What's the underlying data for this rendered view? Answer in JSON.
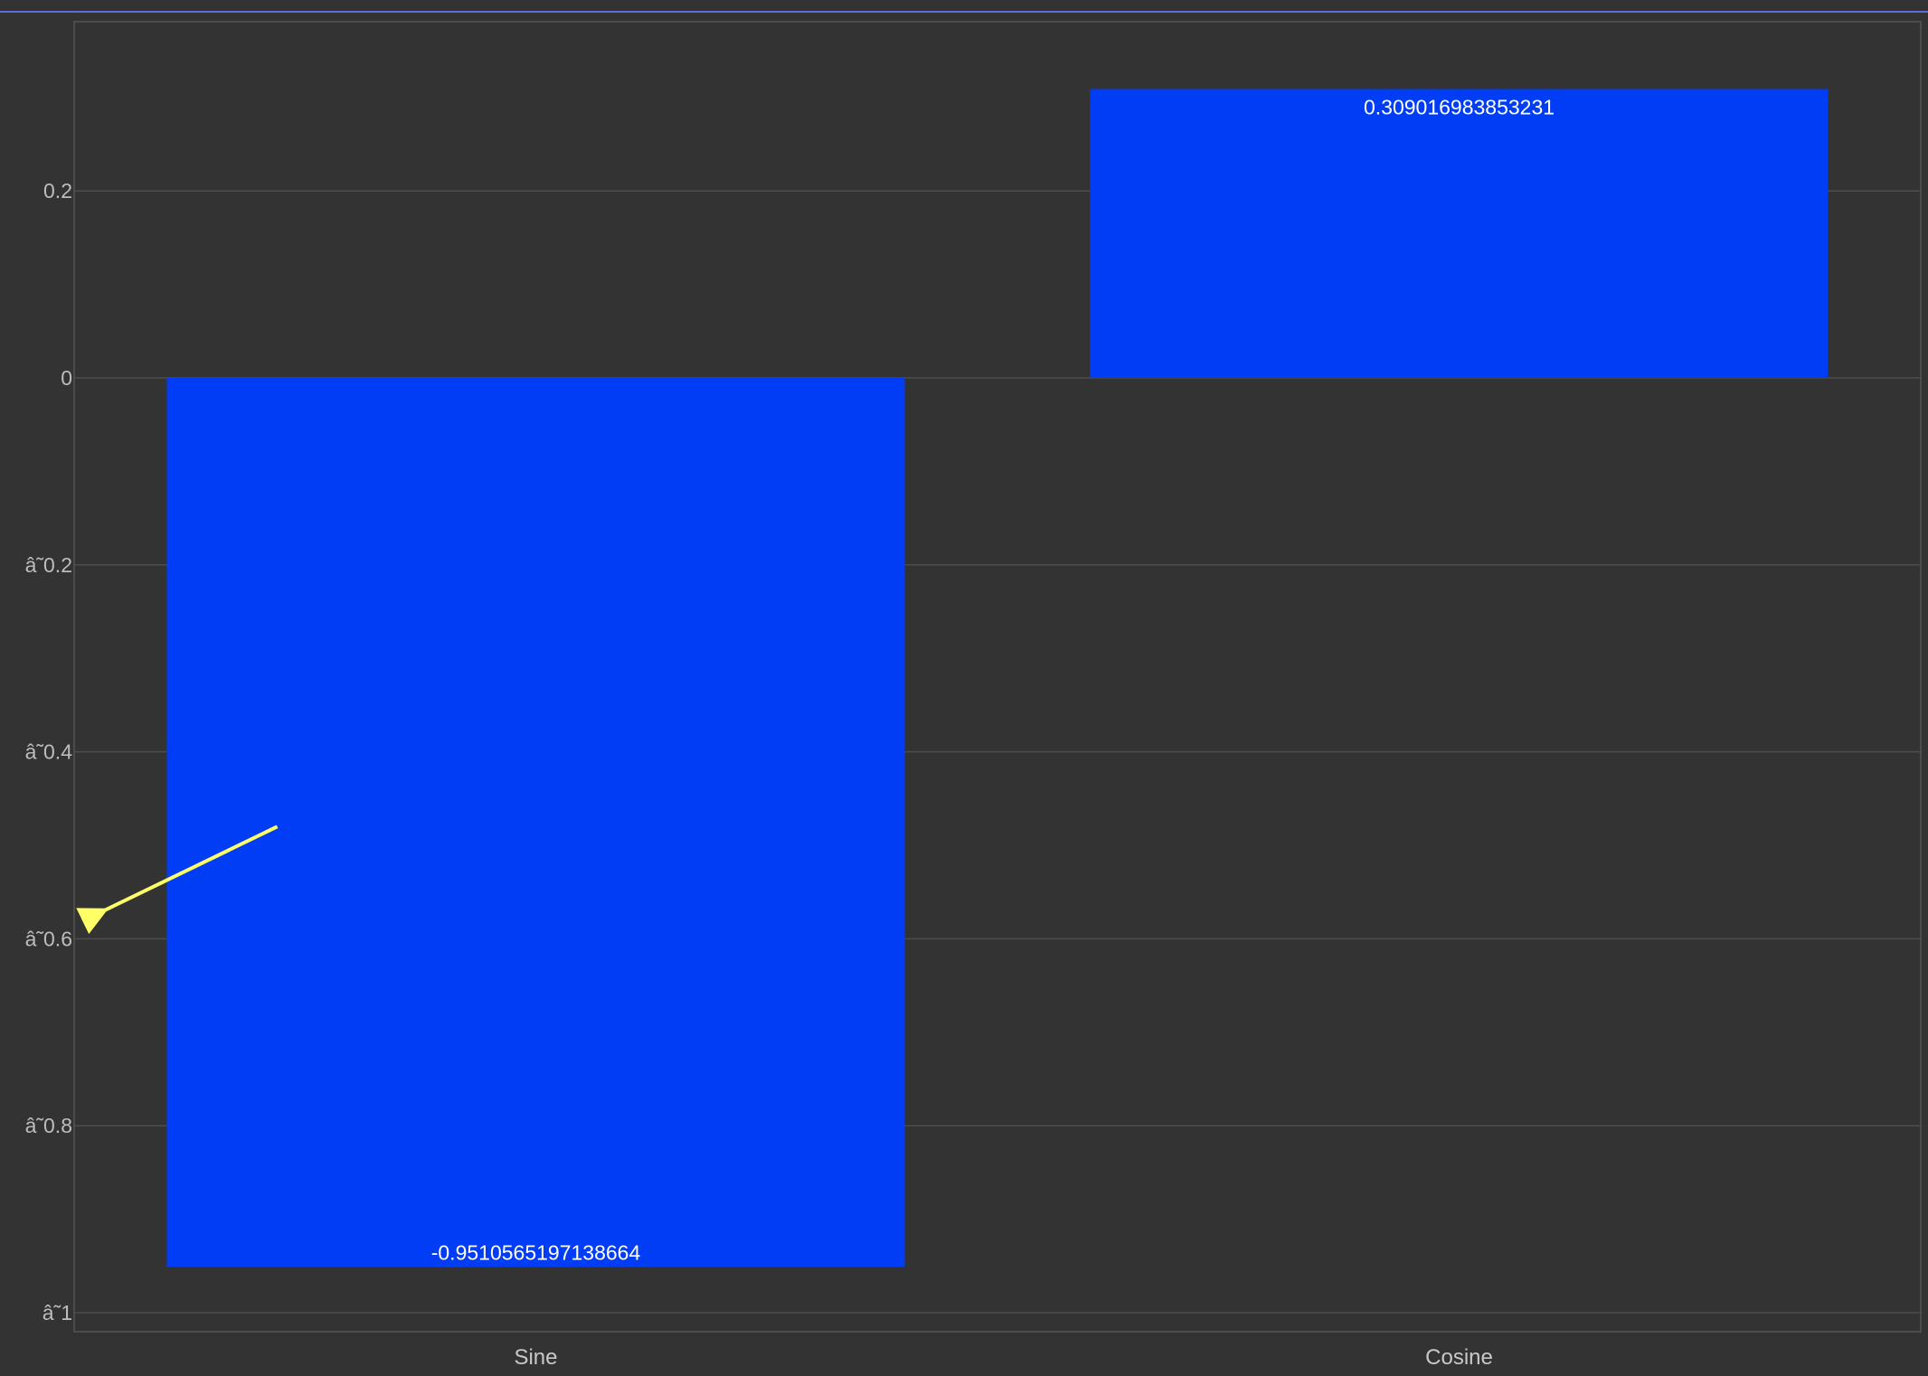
{
  "chart_data": {
    "type": "bar",
    "categories": [
      "Sine",
      "Cosine"
    ],
    "values": [
      -0.9510565197138664,
      0.309016983853231
    ],
    "data_labels": [
      "-0.9510565197138664",
      "0.309016983853231"
    ],
    "y_ticks": [
      {
        "value": 0.2,
        "label": "0.2"
      },
      {
        "value": 0,
        "label": "0"
      },
      {
        "value": -0.2,
        "label": "â˜0.2"
      },
      {
        "value": -0.4,
        "label": "â˜0.4"
      },
      {
        "value": -0.6,
        "label": "â˜0.6"
      },
      {
        "value": -0.8,
        "label": "â˜0.8"
      },
      {
        "value": -1,
        "label": "â˜1"
      }
    ],
    "ylim": [
      -1.02,
      0.38
    ],
    "grid": true,
    "legend": "none",
    "title": "",
    "xlabel": "",
    "ylabel": "",
    "annotation": {
      "type": "arrow",
      "from": {
        "category": "Sine",
        "category_offset": -0.28,
        "y": -0.48
      },
      "to": {
        "category": "Sine",
        "category_offset": -0.48,
        "y": -0.575
      },
      "color": "#ffff66"
    },
    "colors": {
      "bar": "#003df5",
      "background": "#333333",
      "grid": "#4d4d4d",
      "frame": "#555555",
      "top_line": "#5a6fd8"
    }
  }
}
